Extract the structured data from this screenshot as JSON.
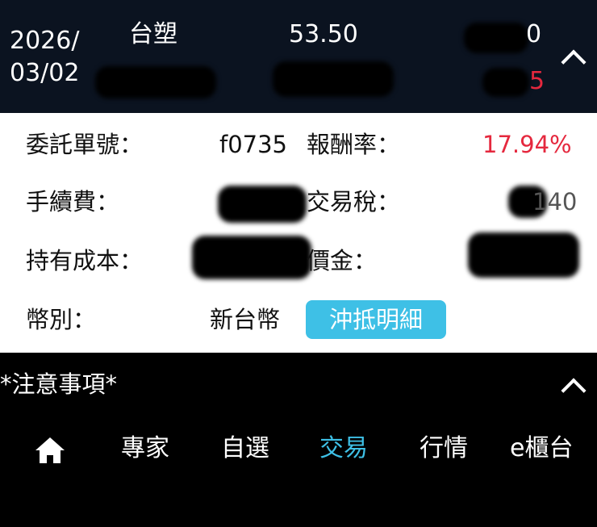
{
  "header": {
    "date_line1": "2026/",
    "date_line2": "03/02",
    "stock_name": "台塑",
    "price": "53.50",
    "right_top_visible": "0",
    "right_bottom_visible": "5"
  },
  "details": {
    "order_no_label": "委託單號：",
    "order_no_value": "f0735",
    "return_rate_label": "報酬率：",
    "return_rate_value": "17.94%",
    "fee_label": "手續費：",
    "tax_label": "交易稅：",
    "tax_visible": "140",
    "cost_label": "持有成本：",
    "price_amount_label": "價金：",
    "currency_label": "幣別：",
    "currency_value": "新台幣",
    "offset_button": "沖抵明細"
  },
  "notice": {
    "title": "*注意事項*"
  },
  "nav": {
    "items": [
      "專家",
      "自選",
      "交易",
      "行情",
      "e櫃台"
    ],
    "active_index": 2
  },
  "colors": {
    "header_bg": "#0b1320",
    "accent": "#3ec0e6",
    "loss_gain_red": "#e5283e"
  }
}
